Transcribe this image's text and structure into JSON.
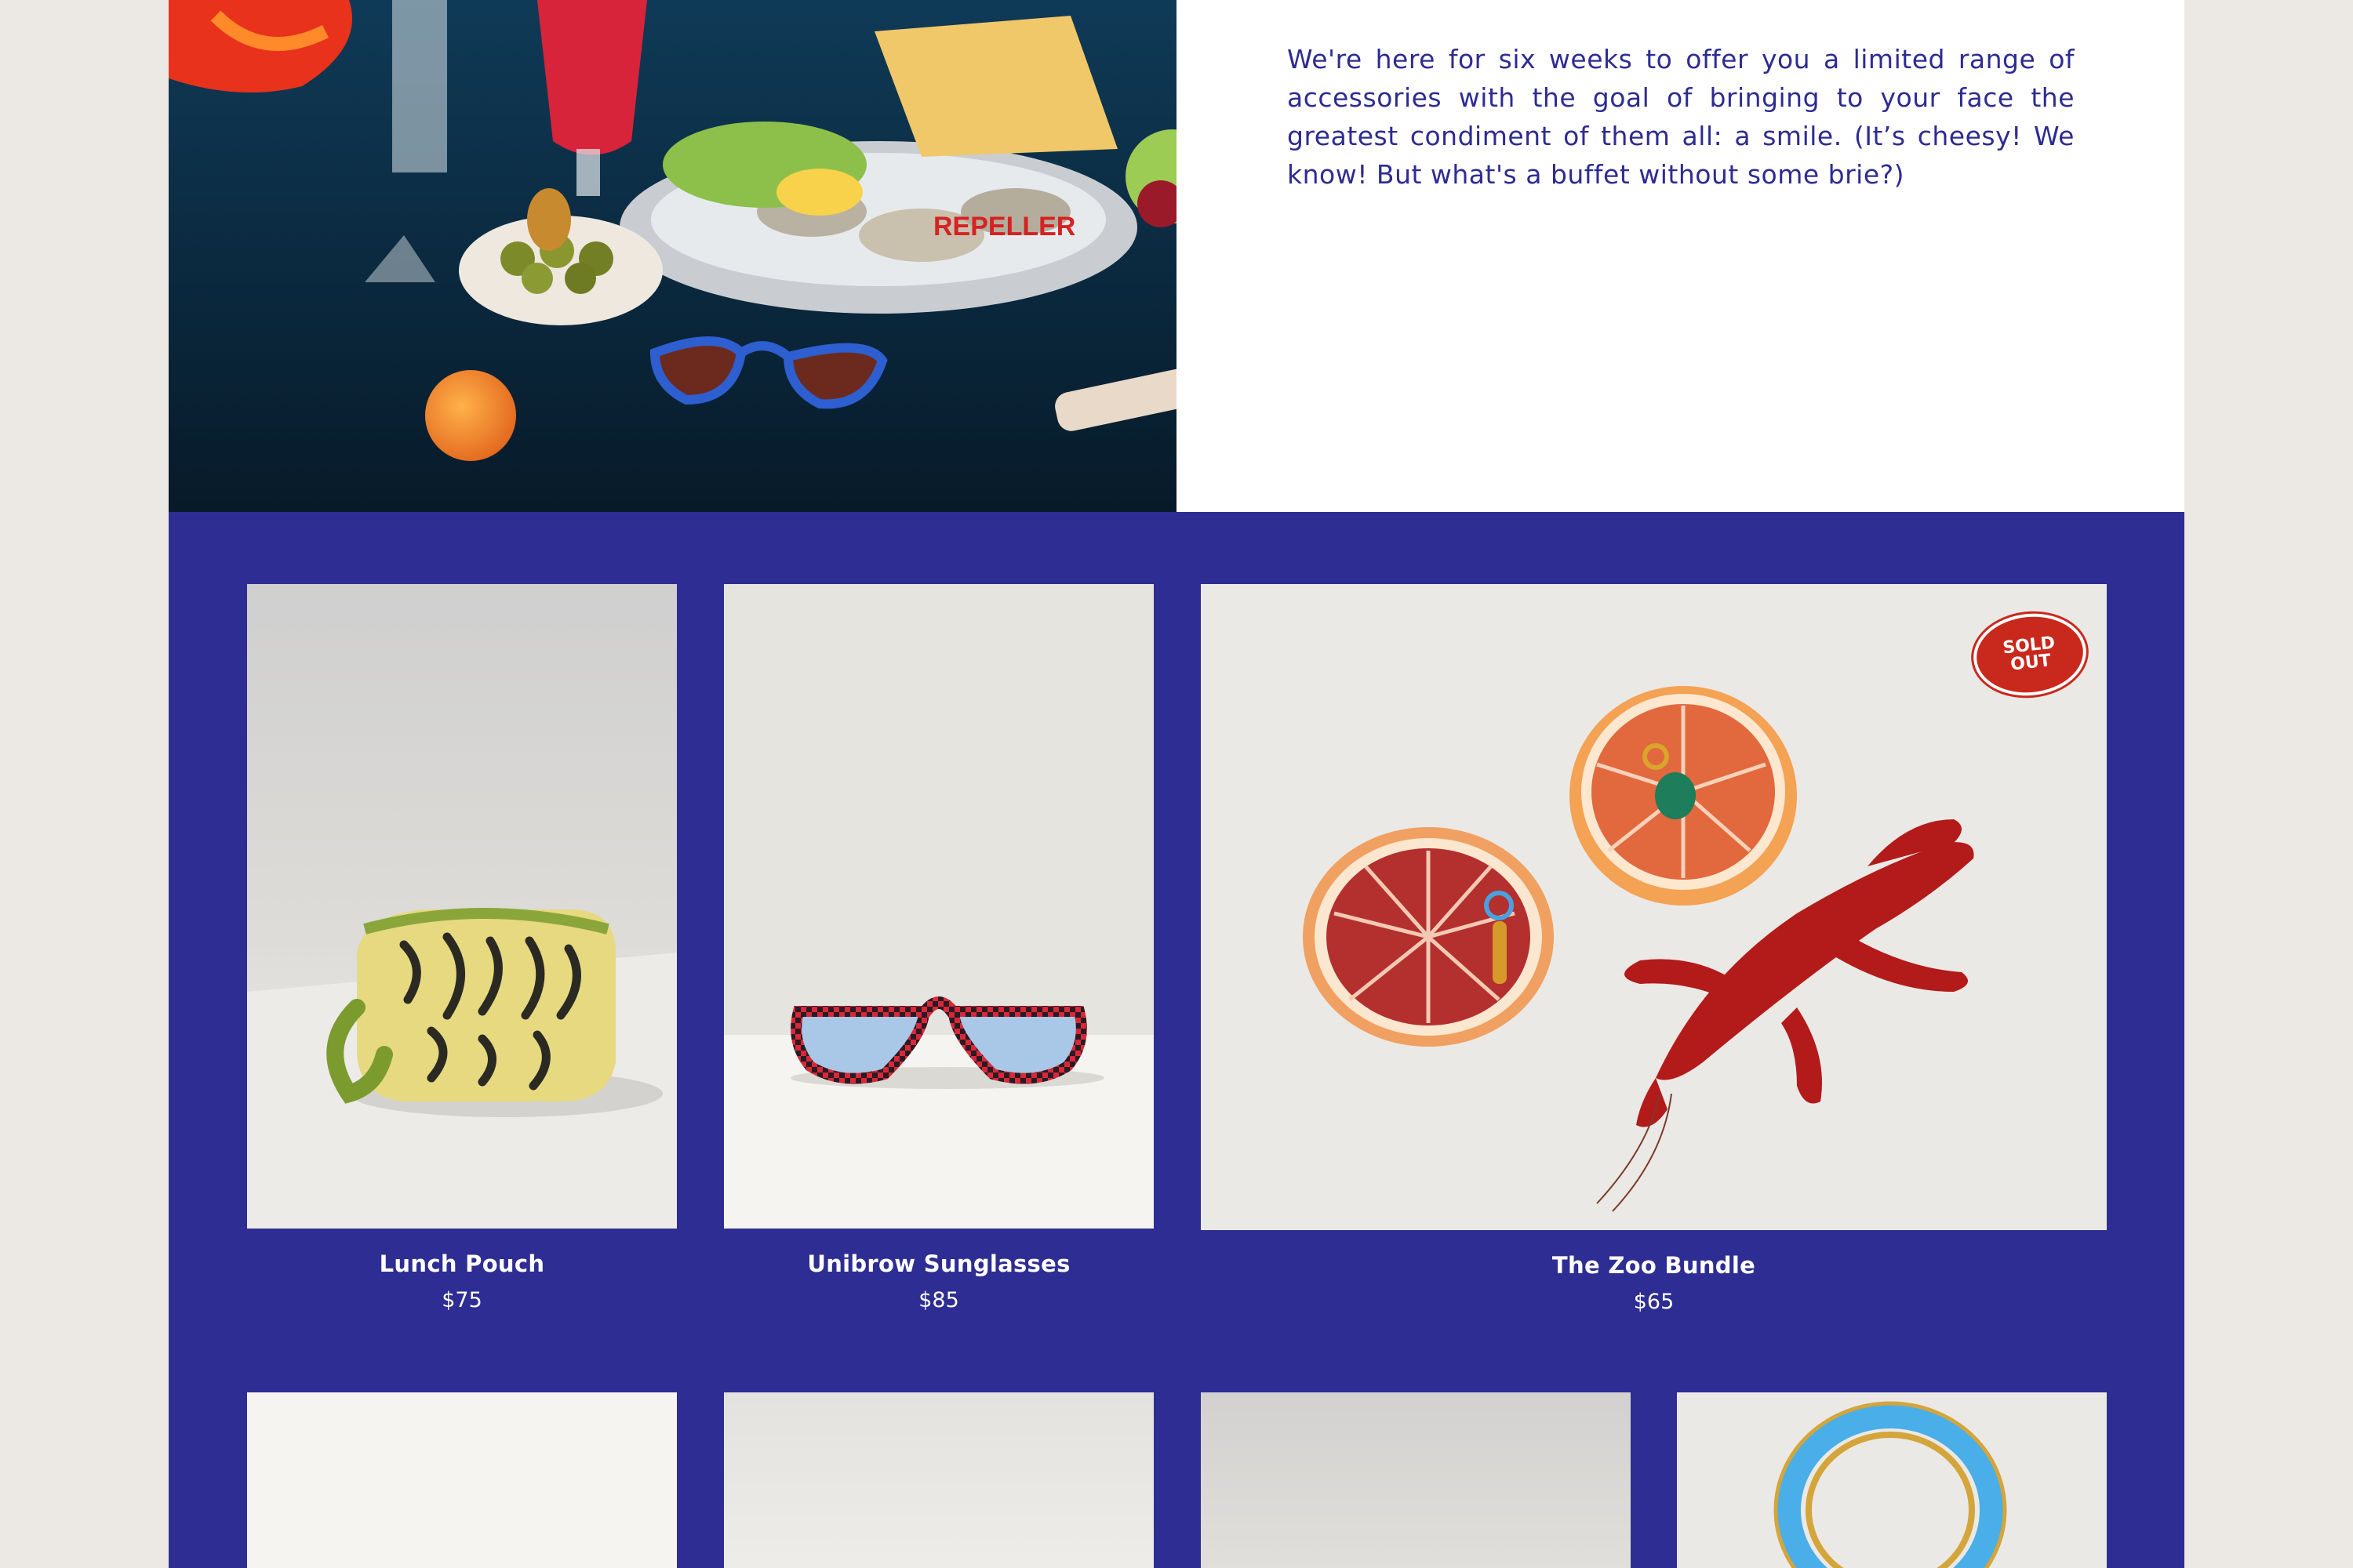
{
  "intro": {
    "text": "We're here for six weeks to offer you a limited range of accessories with the goal of bringing to your face the greatest condiment of them all: a smile. (It’s cheesy! We know! But what's a buffet without some brie?)"
  },
  "hero": {
    "photo_label": "REPELLER"
  },
  "products": [
    {
      "name": "Lunch Pouch",
      "price": "$75",
      "sold_out": false
    },
    {
      "name": "Unibrow Sunglasses",
      "price": "$85",
      "sold_out": false
    },
    {
      "name": "The Zoo Bundle",
      "price": "$65",
      "sold_out": true,
      "badge": "SOLD\nOUT"
    }
  ],
  "colors": {
    "brand_blue": "#2e2d93",
    "text_blue": "#2e2b92",
    "badge_red": "#c9281c",
    "page_bg": "#ece9e4"
  }
}
